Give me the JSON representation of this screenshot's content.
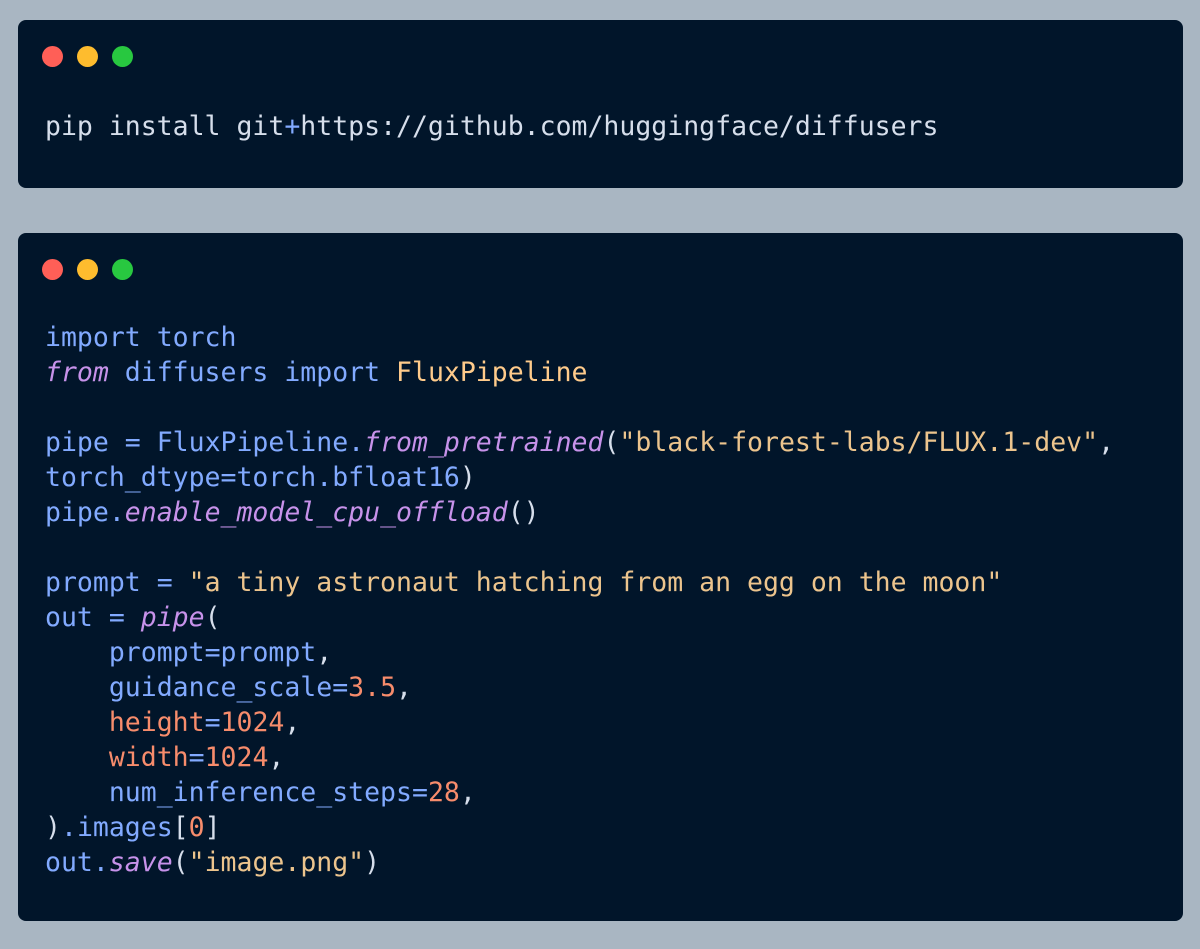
{
  "colors": {
    "page_background": "#a9b6c2",
    "window_background": "#01152a",
    "dot_red": "#ff5f57",
    "dot_yellow": "#febc2e",
    "dot_green": "#28c840",
    "plain": "#d6deeb",
    "identifier": "#82aaff",
    "italic_keyword": "#c792ea",
    "class_name": "#ffcb8b",
    "string": "#ecc48d",
    "number": "#f78c6c",
    "keyword_arg": "#f78c6c"
  },
  "window_controls": {
    "close": "red-dot",
    "minimize": "yellow-dot",
    "maximize": "green-dot"
  },
  "install_snippet": {
    "tokens": [
      {
        "t": "pip install git",
        "c": "plain"
      },
      {
        "t": "+",
        "c": "identifier"
      },
      {
        "t": "https://github.com/huggingface/diffusers",
        "c": "plain"
      }
    ]
  },
  "code_snippet": {
    "lines": [
      [
        {
          "t": "import",
          "c": "identifier"
        },
        {
          "t": " torch",
          "c": "identifier"
        }
      ],
      [
        {
          "t": "from",
          "c": "italic_keyword",
          "i": true
        },
        {
          "t": " diffusers ",
          "c": "identifier"
        },
        {
          "t": "import",
          "c": "identifier"
        },
        {
          "t": " ",
          "c": "plain"
        },
        {
          "t": "FluxPipeline",
          "c": "class_name"
        }
      ],
      [],
      [
        {
          "t": "pipe",
          "c": "identifier"
        },
        {
          "t": " = ",
          "c": "identifier"
        },
        {
          "t": "FluxPipeline",
          "c": "identifier"
        },
        {
          "t": ".",
          "c": "identifier"
        },
        {
          "t": "from_pretrained",
          "c": "italic_keyword",
          "i": true
        },
        {
          "t": "(",
          "c": "plain"
        },
        {
          "t": "\"black-forest-labs/FLUX.1-dev\"",
          "c": "string"
        },
        {
          "t": ",",
          "c": "plain"
        }
      ],
      [
        {
          "t": "torch_dtype",
          "c": "identifier"
        },
        {
          "t": "=",
          "c": "identifier"
        },
        {
          "t": "torch",
          "c": "identifier"
        },
        {
          "t": ".",
          "c": "identifier"
        },
        {
          "t": "bfloat16",
          "c": "identifier"
        },
        {
          "t": ")",
          "c": "plain"
        }
      ],
      [
        {
          "t": "pipe",
          "c": "identifier"
        },
        {
          "t": ".",
          "c": "identifier"
        },
        {
          "t": "enable_model_cpu_offload",
          "c": "italic_keyword",
          "i": true
        },
        {
          "t": "()",
          "c": "plain"
        }
      ],
      [],
      [
        {
          "t": "prompt",
          "c": "identifier"
        },
        {
          "t": " = ",
          "c": "identifier"
        },
        {
          "t": "\"a tiny astronaut hatching from an egg on the moon\"",
          "c": "string"
        }
      ],
      [
        {
          "t": "out",
          "c": "identifier"
        },
        {
          "t": " = ",
          "c": "identifier"
        },
        {
          "t": "pipe",
          "c": "italic_keyword",
          "i": true
        },
        {
          "t": "(",
          "c": "plain"
        }
      ],
      [
        {
          "t": "    ",
          "c": "plain"
        },
        {
          "t": "prompt",
          "c": "identifier"
        },
        {
          "t": "=",
          "c": "identifier"
        },
        {
          "t": "prompt",
          "c": "identifier"
        },
        {
          "t": ",",
          "c": "plain"
        }
      ],
      [
        {
          "t": "    ",
          "c": "plain"
        },
        {
          "t": "guidance_scale",
          "c": "identifier"
        },
        {
          "t": "=",
          "c": "identifier"
        },
        {
          "t": "3.5",
          "c": "number"
        },
        {
          "t": ",",
          "c": "plain"
        }
      ],
      [
        {
          "t": "    ",
          "c": "plain"
        },
        {
          "t": "height",
          "c": "keyword_arg"
        },
        {
          "t": "=",
          "c": "identifier"
        },
        {
          "t": "1024",
          "c": "number"
        },
        {
          "t": ",",
          "c": "plain"
        }
      ],
      [
        {
          "t": "    ",
          "c": "plain"
        },
        {
          "t": "width",
          "c": "keyword_arg"
        },
        {
          "t": "=",
          "c": "identifier"
        },
        {
          "t": "1024",
          "c": "number"
        },
        {
          "t": ",",
          "c": "plain"
        }
      ],
      [
        {
          "t": "    ",
          "c": "plain"
        },
        {
          "t": "num_inference_steps",
          "c": "identifier"
        },
        {
          "t": "=",
          "c": "identifier"
        },
        {
          "t": "28",
          "c": "number"
        },
        {
          "t": ",",
          "c": "plain"
        }
      ],
      [
        {
          "t": ")",
          "c": "plain"
        },
        {
          "t": ".",
          "c": "identifier"
        },
        {
          "t": "images",
          "c": "identifier"
        },
        {
          "t": "[",
          "c": "plain"
        },
        {
          "t": "0",
          "c": "number"
        },
        {
          "t": "]",
          "c": "plain"
        }
      ],
      [
        {
          "t": "out",
          "c": "identifier"
        },
        {
          "t": ".",
          "c": "identifier"
        },
        {
          "t": "save",
          "c": "italic_keyword",
          "i": true
        },
        {
          "t": "(",
          "c": "plain"
        },
        {
          "t": "\"image.png\"",
          "c": "string"
        },
        {
          "t": ")",
          "c": "plain"
        }
      ]
    ]
  }
}
